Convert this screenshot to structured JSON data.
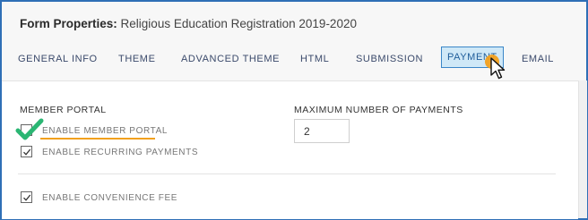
{
  "dialog": {
    "title_prefix": "Form Properties:",
    "form_name": "Religious Education Registration 2019-2020"
  },
  "tabs": [
    {
      "label": "GENERAL INFO",
      "active": false
    },
    {
      "label": "THEME",
      "active": false
    },
    {
      "label": "ADVANCED THEME",
      "active": false
    },
    {
      "label": "HTML",
      "active": false
    },
    {
      "label": "SUBMISSION",
      "active": false
    },
    {
      "label": "PAYMENT",
      "active": true
    },
    {
      "label": "EMAIL",
      "active": false
    }
  ],
  "payment": {
    "member_portal_heading": "MEMBER PORTAL",
    "max_payments_heading": "MAXIMUM NUMBER OF PAYMENTS",
    "max_payments_value": "2",
    "enable_member_portal": {
      "label": "ENABLE MEMBER PORTAL",
      "checked": true
    },
    "enable_recurring_payments": {
      "label": "ENABLE RECURRING PAYMENTS",
      "checked": true
    },
    "enable_convenience_fee": {
      "label": "ENABLE CONVENIENCE FEE",
      "checked": true
    }
  },
  "colors": {
    "frame_border": "#2f6fb6",
    "active_tab_bg": "#cfe8f7",
    "highlight": "#f2a01d",
    "check_green": "#2bb673"
  }
}
